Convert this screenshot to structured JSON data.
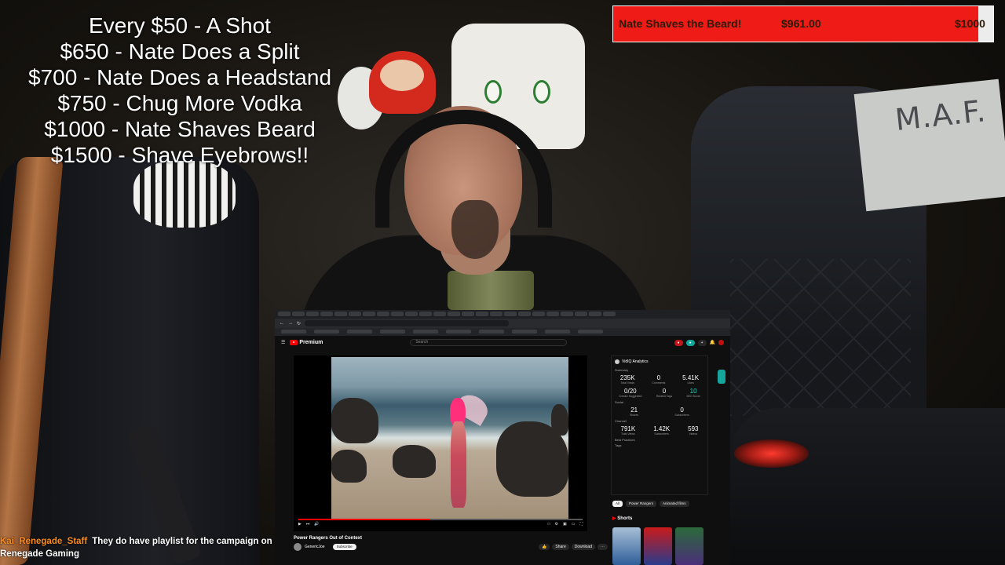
{
  "goals": [
    "Every $50 - A Shot",
    "$650 - Nate Does a Split",
    "$700 - Nate Does a Headstand",
    "$750 - Chug More Vodka",
    "$1000 - Nate Shaves Beard",
    "$1500 - Shave Eyebrows!!"
  ],
  "donation_bar": {
    "goal_name": "Nate Shaves the Beard!",
    "current": "$961.00",
    "target": "$1000",
    "progress": 0.961,
    "fill_color": "#ee1b16"
  },
  "whiteboard": {
    "text": "M.A.F."
  },
  "chat": {
    "username": "Kai_Renegade_Staff",
    "message": "They do have playlist for the campaign on Renegade Gaming"
  },
  "browser": {
    "youtube": {
      "logo": "Premium",
      "search_placeholder": "Search",
      "video_title": "Power Rangers Out of Context",
      "channel": "GenericJoe",
      "subscribe_label": "Subscribe",
      "actions": [
        "Share",
        "Download"
      ],
      "progress": 0.46,
      "vidiq": {
        "title": "VidIQ Analytics",
        "rows": [
          [
            {
              "value": "235K",
              "label": "Total Views"
            },
            {
              "value": "0",
              "label": "Comments"
            },
            {
              "value": "5.41K",
              "label": "Likes"
            }
          ],
          [
            {
              "value": "0/20",
              "label": "Creator Suggested"
            },
            {
              "value": "0",
              "label": "Related Tags"
            },
            {
              "value": "10",
              "label": "SEO Score"
            }
          ],
          [
            {
              "value": "21",
              "label": "Shares"
            },
            {
              "value": "0",
              "label": "Subscribers"
            }
          ],
          [
            {
              "value": "791K",
              "label": "Total Views"
            },
            {
              "value": "1.42K",
              "label": "Subscribers"
            },
            {
              "value": "593",
              "label": "Videos"
            }
          ]
        ],
        "sections": [
          "Summary",
          "Social",
          "Channel",
          "Best Practices",
          "Tags"
        ]
      },
      "filter_chips": [
        "All",
        "Power Rangers",
        "Animated films"
      ],
      "shorts_label": "Shorts"
    }
  }
}
